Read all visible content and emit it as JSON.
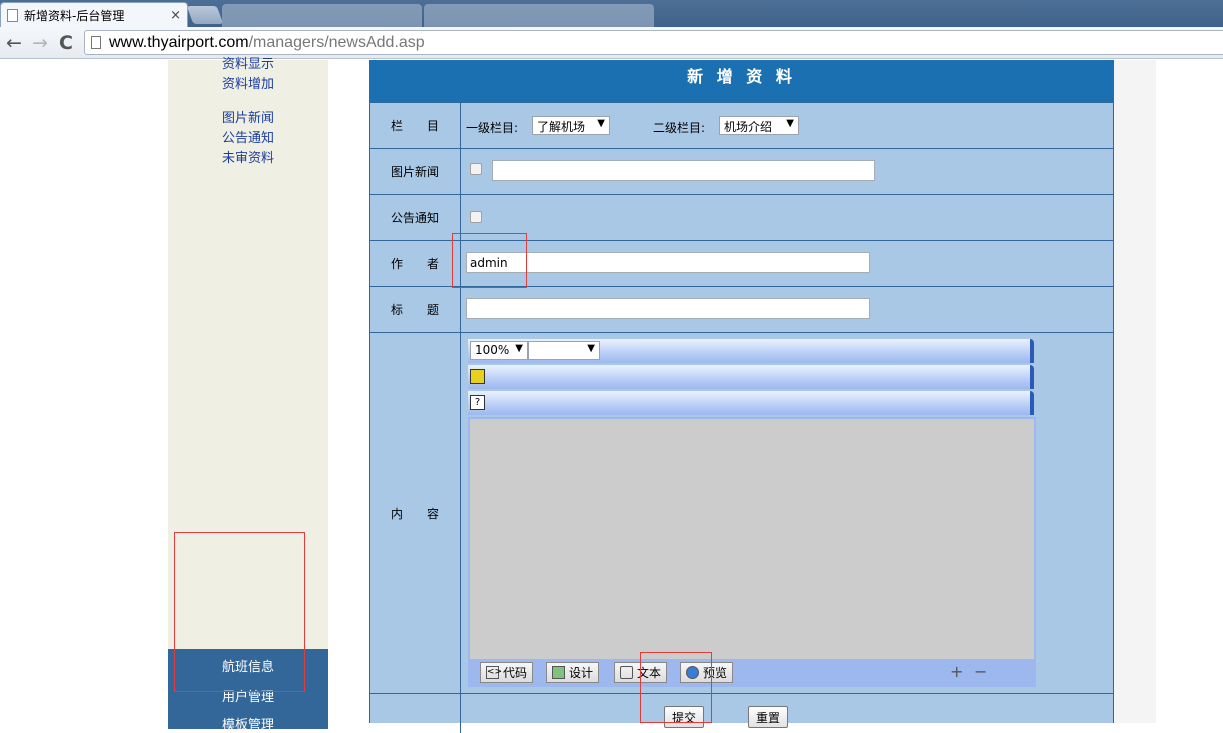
{
  "browser": {
    "tab_title": "新增资料-后台管理",
    "tab_close": "×",
    "back": "←",
    "forward": "→",
    "reload": "C",
    "url_host": "www.thyairport.com",
    "url_path": "/managers/newsAdd.asp"
  },
  "sidebar": {
    "links": [
      "资料显示",
      "资料增加",
      "图片新闻",
      "公告通知",
      "未审资料"
    ],
    "menu": [
      "航班信息",
      "用户管理",
      "模板管理"
    ]
  },
  "form": {
    "header": "新 增 资 料",
    "rows": {
      "column": {
        "label": "栏　　目",
        "level1_label": "一级栏目:",
        "level1_value": "了解机场",
        "level2_label": "二级栏目:",
        "level2_value": "机场介绍"
      },
      "photo_news": {
        "label": "图片新闻",
        "input_value": ""
      },
      "notice": {
        "label": "公告通知"
      },
      "author": {
        "label": "作　　者",
        "value": "admin"
      },
      "title": {
        "label": "标　　题",
        "value": ""
      },
      "content": {
        "label": "内　　容",
        "zoom": "100%",
        "zoom_arrow": "▼",
        "font_arrow": "▼",
        "mode_buttons": [
          "代码",
          "设计",
          "文本",
          "预览"
        ],
        "plus": "+",
        "minus": "−"
      }
    },
    "submit": "提交",
    "reset": "重置"
  },
  "colors": {
    "header_bg": "#1a70b0",
    "form_bg": "#a8c8e6",
    "sidebar_bg": "#efefe3",
    "sidebar_menu_bg": "#336699",
    "annotation": "#e03c3c"
  }
}
